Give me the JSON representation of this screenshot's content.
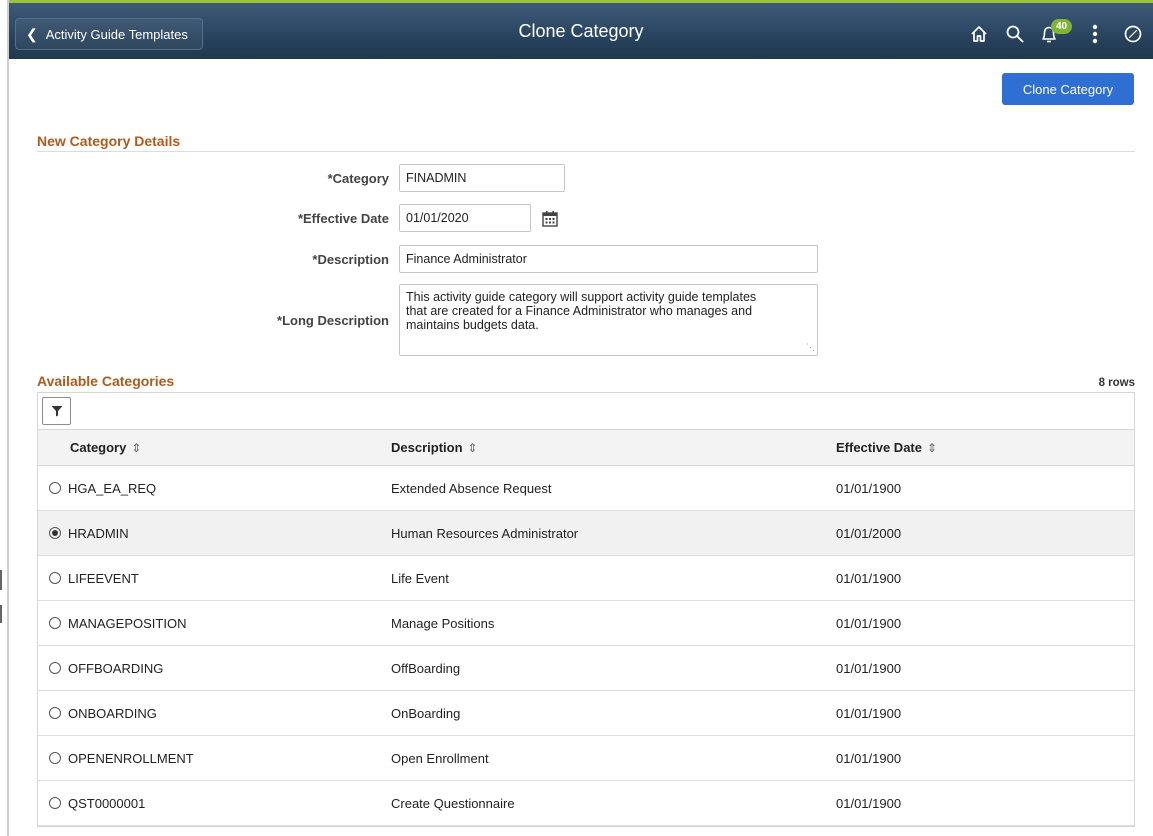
{
  "header": {
    "back_label": "Activity Guide Templates",
    "title": "Clone Category",
    "notification_count": "40"
  },
  "actions": {
    "clone_label": "Clone Category"
  },
  "details": {
    "section_title": "New Category Details",
    "category_label": "*Category",
    "category_value": "FINADMIN",
    "effective_date_label": "*Effective Date",
    "effective_date_value": "01/01/2020",
    "description_label": "*Description",
    "description_value": "Finance Administrator",
    "long_description_label": "*Long Description",
    "long_description_lines": [
      "This activity guide category will support activity guide templates",
      "that are created for a Finance Administrator who manages and",
      "maintains budgets data."
    ]
  },
  "available": {
    "section_title": "Available Categories",
    "rows_label": "8 rows",
    "columns": [
      "Category",
      "Description",
      "Effective Date"
    ],
    "rows": [
      {
        "category": "HGA_EA_REQ",
        "description": "Extended Absence Request",
        "date": "01/01/1900",
        "selected": false
      },
      {
        "category": "HRADMIN",
        "description": "Human Resources Administrator",
        "date": "01/01/2000",
        "selected": true
      },
      {
        "category": "LIFEEVENT",
        "description": "Life Event",
        "date": "01/01/1900",
        "selected": false
      },
      {
        "category": "MANAGEPOSITION",
        "description": "Manage Positions",
        "date": "01/01/1900",
        "selected": false
      },
      {
        "category": "OFFBOARDING",
        "description": "OffBoarding",
        "date": "01/01/1900",
        "selected": false
      },
      {
        "category": "ONBOARDING",
        "description": "OnBoarding",
        "date": "01/01/1900",
        "selected": false
      },
      {
        "category": "OPENENROLLMENT",
        "description": "Open Enrollment",
        "date": "01/01/1900",
        "selected": false
      },
      {
        "category": "QST0000001",
        "description": "Create Questionnaire",
        "date": "01/01/1900",
        "selected": false
      }
    ]
  },
  "icons": {
    "back": "chevron-left-icon",
    "home": "home-icon",
    "search": "search-icon",
    "notifications": "bell-icon",
    "actions": "more-vertical-icon",
    "navbar": "compass-icon",
    "calendar": "calendar-icon",
    "filter": "filter-icon",
    "sort": "sort-icon"
  },
  "colors": {
    "header_bg": "#26405b",
    "header_accent": "#9ac33a",
    "primary_button": "#2f6ed3",
    "section_title": "#b05a1e",
    "badge": "#7fb537"
  }
}
